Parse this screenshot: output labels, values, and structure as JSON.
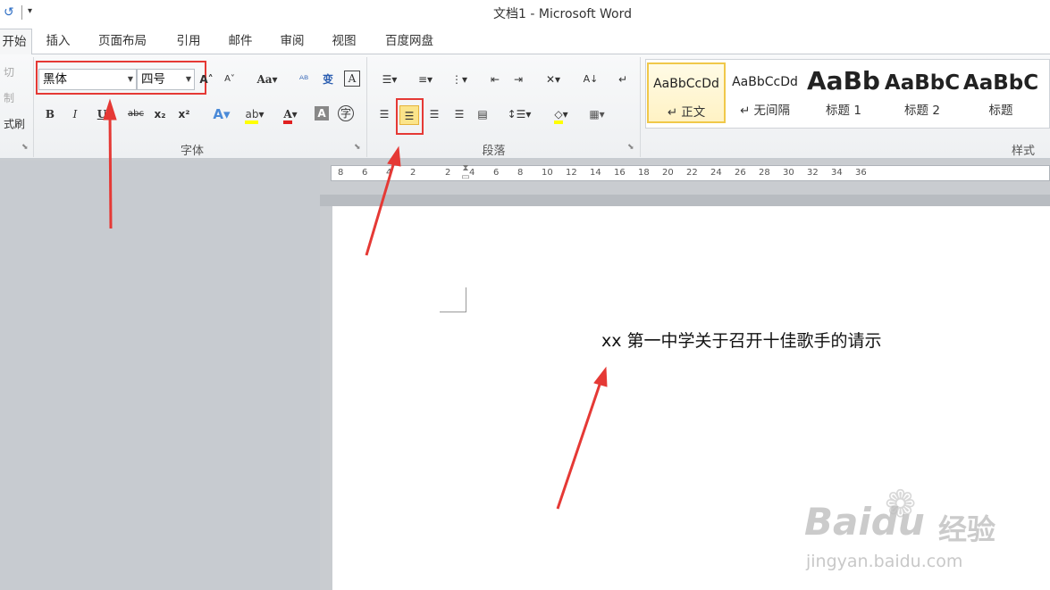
{
  "window": {
    "title": "文档1 - Microsoft Word"
  },
  "tabs": [
    {
      "label": "开始"
    },
    {
      "label": "插入"
    },
    {
      "label": "页面布局"
    },
    {
      "label": "引用"
    },
    {
      "label": "邮件"
    },
    {
      "label": "审阅"
    },
    {
      "label": "视图"
    },
    {
      "label": "百度网盘"
    }
  ],
  "clipboard": {
    "cut": "切",
    "copy": "制",
    "format_painter": "式刷"
  },
  "font": {
    "name": "黑体",
    "size": "四号",
    "group_label": "字体"
  },
  "paragraph": {
    "group_label": "段落"
  },
  "styles": {
    "group_label": "样式",
    "items": [
      {
        "preview": "AaBbCcDd",
        "name": "↵ 正文"
      },
      {
        "preview": "AaBbCcDd",
        "name": "↵ 无间隔"
      },
      {
        "preview": "AaBb",
        "name": "标题 1"
      },
      {
        "preview": "AaBbC",
        "name": "标题 2"
      },
      {
        "preview": "AaBbC",
        "name": "标题"
      }
    ]
  },
  "ruler": {
    "numbers": [
      "8",
      "6",
      "4",
      "2",
      "2",
      "4",
      "6",
      "8",
      "10",
      "12",
      "14",
      "16",
      "18",
      "20",
      "22",
      "24",
      "26",
      "28",
      "30",
      "32",
      "34",
      "36"
    ]
  },
  "document": {
    "text": "xx 第一中学关于召开十佳歌手的请示"
  },
  "watermark": {
    "brand": "Baidu",
    "suffix": "经验",
    "url": "jingyan.baidu.com"
  },
  "colors": {
    "highlight_box": "#e53935",
    "arrow": "#e53935",
    "ribbon_bg": "#f4f5f6",
    "style_selected": "#f8d45c"
  }
}
